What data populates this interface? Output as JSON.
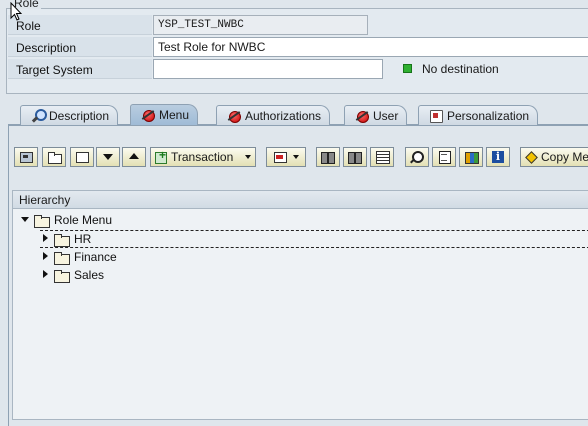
{
  "header": {
    "group_title": "Role",
    "role_label": "Role",
    "role_value": "YSP_TEST_NWBC",
    "description_label": "Description",
    "description_value": "Test Role for NWBC",
    "target_system_label": "Target System",
    "target_system_value": "",
    "destination_status": "No destination",
    "destination_color": "#2fb031"
  },
  "tabs": [
    {
      "label": "Description",
      "icon": "magnifier-icon",
      "active": false
    },
    {
      "label": "Menu",
      "icon": "status-red-icon",
      "active": true
    },
    {
      "label": "Authorizations",
      "icon": "status-red-icon",
      "active": false
    },
    {
      "label": "User",
      "icon": "status-red-icon",
      "active": false
    },
    {
      "label": "Personalization",
      "icon": "personalization-icon",
      "active": false
    }
  ],
  "toolbar": {
    "transaction_label": "Transaction",
    "copy_menus_label": "Copy Me"
  },
  "tree": {
    "header": "Hierarchy",
    "root": "Role Menu",
    "children": [
      "HR",
      "Finance",
      "Sales"
    ]
  }
}
